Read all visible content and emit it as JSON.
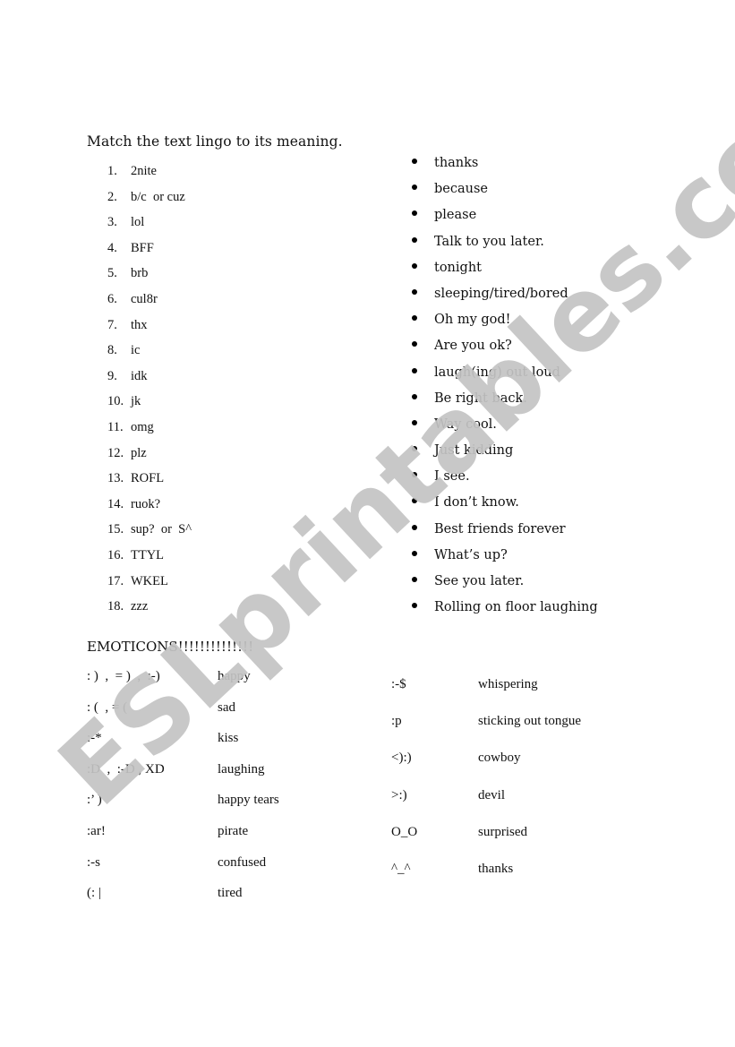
{
  "worksheet": {
    "title": "Match the text lingo to its meaning.",
    "lingo": [
      {
        "num": "1.",
        "text": "2nite"
      },
      {
        "num": "2.",
        "text": "b/c  or cuz"
      },
      {
        "num": "3.",
        "text": "lol"
      },
      {
        "num": "4.",
        "text": "BFF"
      },
      {
        "num": "5.",
        "text": "brb"
      },
      {
        "num": "6.",
        "text": "cul8r"
      },
      {
        "num": "7.",
        "text": "thx"
      },
      {
        "num": "8.",
        "text": "ic"
      },
      {
        "num": "9.",
        "text": "idk"
      },
      {
        "num": "10.",
        "text": "jk"
      },
      {
        "num": "11.",
        "text": "omg"
      },
      {
        "num": "12.",
        "text": "plz"
      },
      {
        "num": "13.",
        "text": "ROFL"
      },
      {
        "num": "14.",
        "text": "ruok?"
      },
      {
        "num": "15.",
        "text": "sup?  or  S^"
      },
      {
        "num": "16.",
        "text": "TTYL"
      },
      {
        "num": "17.",
        "text": "WKEL"
      },
      {
        "num": "18.",
        "text": "zzz"
      }
    ],
    "meanings": [
      "thanks",
      "because",
      "please",
      "Talk to you later.",
      "tonight",
      "sleeping/tired/bored",
      "Oh my god!",
      "Are you ok?",
      "laugh(ing) out loud",
      "Be right back.",
      "Way cool.",
      "Just kidding",
      "I see.",
      "I don’t know.",
      "Best friends forever",
      "What’s up?",
      "See you later.",
      "Rolling on floor laughing"
    ],
    "emoticons_heading": "EMOTICONS!!!!!!!!!!!!!!",
    "emoticons_left": [
      {
        "symbol": ": )  ,  = )  ,  :-)",
        "meaning": "happy"
      },
      {
        "symbol": ": (  , = (",
        "meaning": "sad"
      },
      {
        "symbol": ":-*",
        "meaning": "kiss"
      },
      {
        "symbol": ":D  ,  :-D , XD",
        "meaning": "laughing"
      },
      {
        "symbol": ":’ )",
        "meaning": "happy tears"
      },
      {
        "symbol": ":ar!",
        "meaning": "pirate"
      },
      {
        "symbol": ":-s",
        "meaning": "confused"
      },
      {
        "symbol": "(: |",
        "meaning": "tired"
      }
    ],
    "emoticons_right": [
      {
        "symbol": ":-$",
        "meaning": "whispering"
      },
      {
        "symbol": ":p",
        "meaning": "sticking out tongue"
      },
      {
        "symbol": "<):)",
        "meaning": "cowboy"
      },
      {
        "symbol": ">:)",
        "meaning": "devil"
      },
      {
        "symbol": "O_O",
        "meaning": "surprised"
      },
      {
        "symbol": "^_^",
        "meaning": "thanks"
      }
    ],
    "watermark": "ESLprintables.com"
  }
}
